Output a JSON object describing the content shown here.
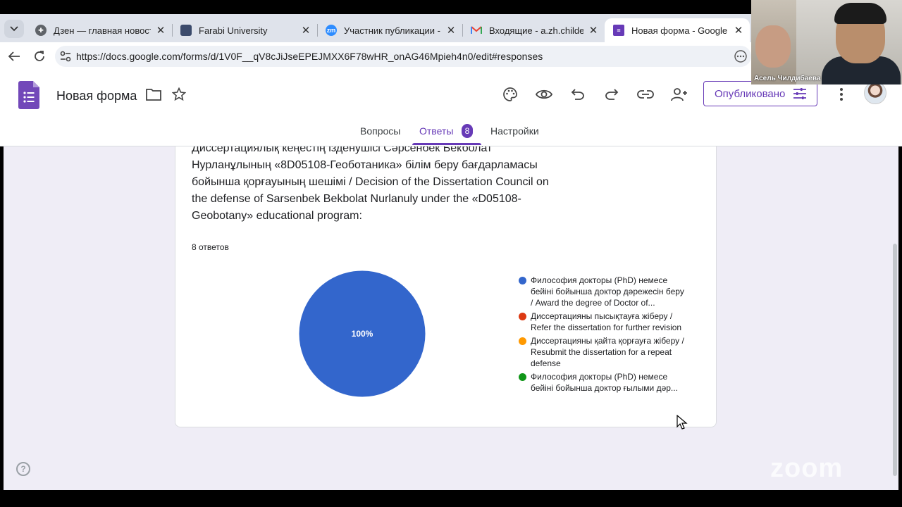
{
  "browser": {
    "tabs": [
      {
        "title": "Дзен — главная новостна",
        "favicon_color": "#5f6368"
      },
      {
        "title": "Farabi University",
        "favicon_color": "#3b4a6b"
      },
      {
        "title": "Участник публикации - Zoo",
        "favicon_color": "#2d8cff"
      },
      {
        "title": "Входящие - a.zh.childebaev",
        "favicon_color": "#ea4335"
      },
      {
        "title": "Новая форма - Google Фор",
        "favicon_color": "#673ab7"
      }
    ],
    "url": "https://docs.google.com/forms/d/1V0F__qV8cJiJseEPEJMXX6F78wHR_onAG46Mpieh4n0/edit#responses"
  },
  "forms": {
    "title": "Новая форма",
    "publish_label": "Опубликовано",
    "tabs": {
      "questions": "Вопросы",
      "responses": "Ответы",
      "responses_count": "8",
      "settings": "Настройки"
    }
  },
  "question": {
    "text": "Диссертациялық кеңестің ізденушісі Сәрсенбек Бекболат Нурланұлының «8D05108-Геоботаника» білім беру бағдарламасы бойынша қорғауының шешімі / Decision of the Dissertation Council on the defense of Sarsenbek Bekbolat Nurlanuly under the «D05108-Geobotany» educational program:",
    "answers_count": "8 ответов"
  },
  "chart_data": {
    "type": "pie",
    "categories": [
      "Философия докторы (PhD) немесе бейіні бойынша доктор дәрежесін беру / Award the degree of Doctor of...",
      "Диссертацияны пысықтауға жіберу / Refer the dissertation for further revision",
      "Диссертацияны қайта қорғауға жіберу / Resubmit the dissertation for a repeat defense",
      "Философия докторы (PhD) немесе бейіні бойынша доктор ғылыми дәр..."
    ],
    "values": [
      8,
      0,
      0,
      0
    ],
    "colors": [
      "#3366cc",
      "#dc3912",
      "#ff9900",
      "#109618"
    ],
    "slice_label": "100%",
    "legend_position": "right"
  },
  "video": {
    "participant_name": "Асель Чилдибаева"
  },
  "watermark": "zoom",
  "help_label": "?"
}
